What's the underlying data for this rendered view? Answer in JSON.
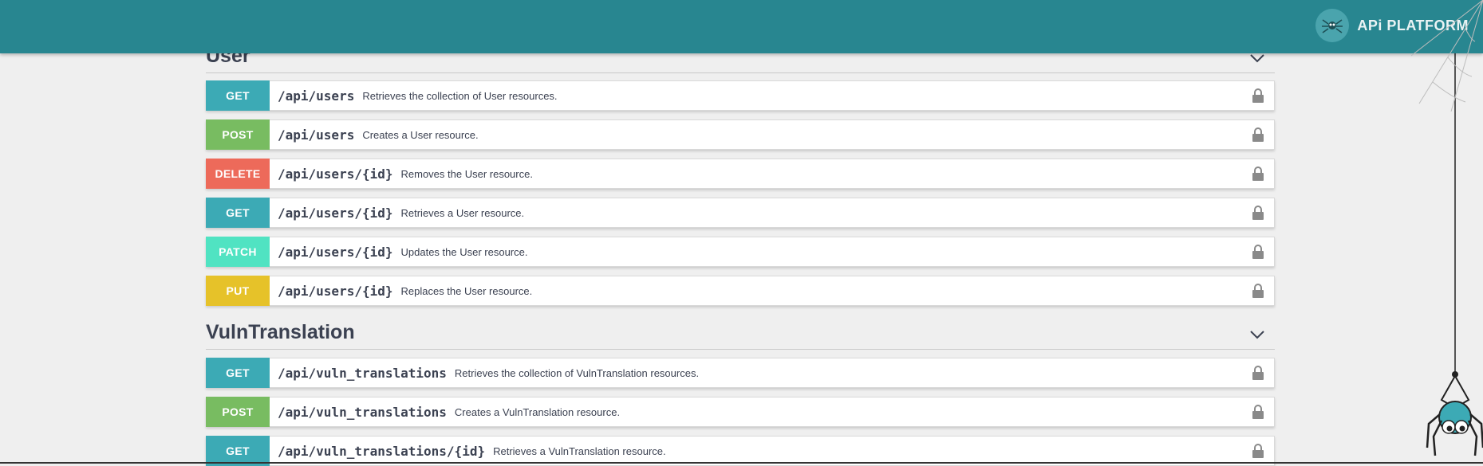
{
  "header": {
    "brand_text": "APi PLATFORM",
    "color": "#288690"
  },
  "sections": {
    "user": {
      "title": "User",
      "operations": [
        {
          "method": "GET",
          "path": "/api/users",
          "summary": "Retrieves the collection of User resources."
        },
        {
          "method": "POST",
          "path": "/api/users",
          "summary": "Creates a User resource."
        },
        {
          "method": "DELETE",
          "path": "/api/users/{id}",
          "summary": "Removes the User resource."
        },
        {
          "method": "GET",
          "path": "/api/users/{id}",
          "summary": "Retrieves a User resource."
        },
        {
          "method": "PATCH",
          "path": "/api/users/{id}",
          "summary": "Updates the User resource."
        },
        {
          "method": "PUT",
          "path": "/api/users/{id}",
          "summary": "Replaces the User resource."
        }
      ]
    },
    "vuln": {
      "title": "VulnTranslation",
      "operations": [
        {
          "method": "GET",
          "path": "/api/vuln_translations",
          "summary": "Retrieves the collection of VulnTranslation resources."
        },
        {
          "method": "POST",
          "path": "/api/vuln_translations",
          "summary": "Creates a VulnTranslation resource."
        },
        {
          "method": "GET",
          "path": "/api/vuln_translations/{id}",
          "summary": "Retrieves a VulnTranslation resource."
        }
      ]
    }
  },
  "method_colors": {
    "GET": "#3caab5",
    "POST": "#78bc61",
    "DELETE": "#ed6a5a",
    "PATCH": "#50e3c2",
    "PUT": "#e6c229"
  },
  "icons": [
    "lock-icon",
    "chevron-down-icon",
    "spider-logo-icon",
    "spider-web-icon",
    "spider-mascot-icon"
  ]
}
